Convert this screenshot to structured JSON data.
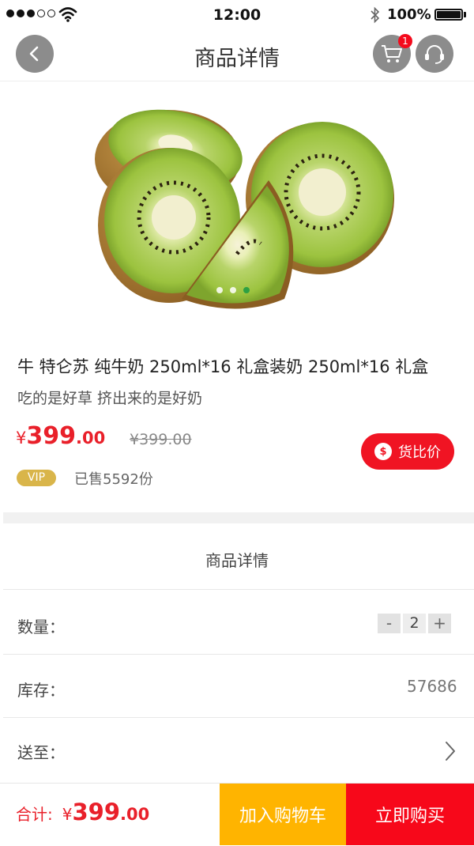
{
  "status_bar": {
    "time": "12:00",
    "battery": "100%",
    "icons": [
      "signal-dots-icon",
      "wifi-icon",
      "bluetooth-icon",
      "battery-icon"
    ]
  },
  "nav": {
    "title": "商品详情",
    "cart_badge": "1",
    "icons": [
      "back-arrow-icon",
      "cart-icon",
      "headset-icon"
    ]
  },
  "gallery": {
    "image": "kiwi-fruit-image",
    "pager_count": 3,
    "pager_active_index": 2
  },
  "product": {
    "name": "牛 特仑苏 纯牛奶 250ml*16 礼盒装奶 250ml*16 礼盒",
    "slogan": "吃的是好草 挤出来的是好奶",
    "price_symbol": "¥",
    "price_integer": "399",
    "price_decimal": ".00",
    "original_price": "¥399.00",
    "compare_label": "货比价",
    "compare_icon_glyph": "$",
    "vip_label": "VIP",
    "sold_text": "已售5592份"
  },
  "details": {
    "section_title": "商品详情",
    "quantity_label": "数量：",
    "minus": "-",
    "quantity": "2",
    "plus": "+",
    "stock_label": "库存：",
    "stock_value": "57686",
    "ship_label": "送至："
  },
  "footer": {
    "total_label": "合计:",
    "total_symbol": "¥",
    "total_integer": "399",
    "total_decimal": ".00",
    "add_to_cart": "加入购物车",
    "buy_now": "立即购买"
  },
  "colors": {
    "accent_red": "#e9202a",
    "button_red": "#f7081a",
    "button_orange": "#ffb400",
    "vip_gold": "#d9b54a",
    "active_dot": "#2ea043"
  }
}
